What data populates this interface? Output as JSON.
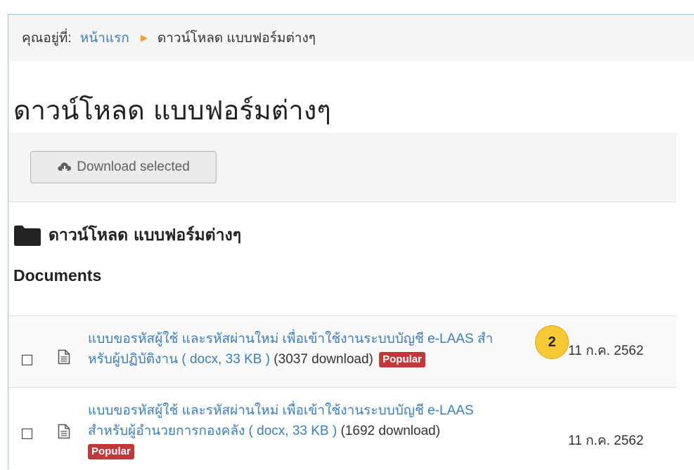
{
  "breadcrumb": {
    "prefix": "คุณอยู่ที่:",
    "home": "หน้าแรก",
    "current": "ดาวน์โหลด แบบฟอร์มต่างๆ"
  },
  "page_title": "ดาวน์โหลด แบบฟอร์มต่างๆ",
  "toolbar": {
    "download_selected": "Download selected"
  },
  "category": {
    "name": "ดาวน์โหลด แบบฟอร์มต่างๆ"
  },
  "documents_heading": "Documents",
  "documents": [
    {
      "title_line1": "แบบขอรหัสผู้ใช้ และรหัสผ่านใหม่ เพื่อเข้าใช้งานระบบบัญชี e-LAAS สำ",
      "title_line2": "หรับผู้ปฏิบัติงาน ( docx, 33 KB )",
      "downloads": "(3037 download)",
      "badge": "Popular",
      "date": "11 ก.ค. 2562"
    },
    {
      "title_line1": "แบบขอรหัสผู้ใช้ และรหัสผ่านใหม่ เพื่อเข้าใช้งานระบบบัญชี e-LAAS",
      "title_line2": "สำหรับผู้อำนวยการกองคลัง ( docx, 33 KB )",
      "downloads": "(1692 download)",
      "badge": "Popular",
      "date": "11 ก.ค. 2562"
    }
  ],
  "step_marker": "2",
  "colors": {
    "link": "#3a7ec0",
    "badge": "#c1373a",
    "marker": "#f7c934",
    "frame": "#9ec3e6"
  }
}
